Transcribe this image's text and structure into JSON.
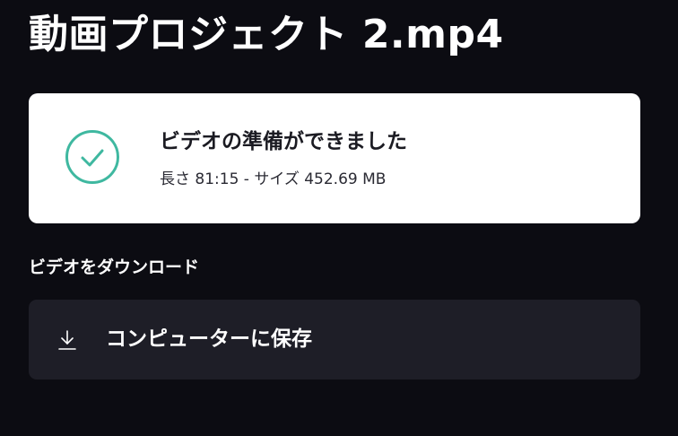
{
  "header": {
    "title": "動画プロジェクト 2.mp4"
  },
  "status_card": {
    "icon": "check-circle-icon",
    "title": "ビデオの準備ができました",
    "meta": "長さ 81:15 - サイズ 452.69 MB"
  },
  "download": {
    "section_label": "ビデオをダウンロード",
    "save_icon": "download-icon",
    "save_label": "コンピューターに保存"
  },
  "colors": {
    "background": "#0c0c12",
    "card": "#ffffff",
    "button": "#1e1e27",
    "accent": "#3fb8a0"
  }
}
